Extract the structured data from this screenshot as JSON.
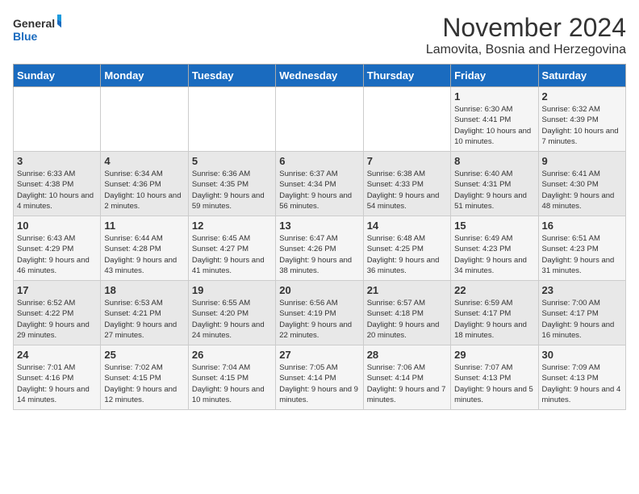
{
  "logo": {
    "general": "General",
    "blue": "Blue"
  },
  "title": "November 2024",
  "subtitle": "Lamovita, Bosnia and Herzegovina",
  "days_of_week": [
    "Sunday",
    "Monday",
    "Tuesday",
    "Wednesday",
    "Thursday",
    "Friday",
    "Saturday"
  ],
  "weeks": [
    [
      {
        "day": "",
        "info": ""
      },
      {
        "day": "",
        "info": ""
      },
      {
        "day": "",
        "info": ""
      },
      {
        "day": "",
        "info": ""
      },
      {
        "day": "",
        "info": ""
      },
      {
        "day": "1",
        "info": "Sunrise: 6:30 AM\nSunset: 4:41 PM\nDaylight: 10 hours and 10 minutes."
      },
      {
        "day": "2",
        "info": "Sunrise: 6:32 AM\nSunset: 4:39 PM\nDaylight: 10 hours and 7 minutes."
      }
    ],
    [
      {
        "day": "3",
        "info": "Sunrise: 6:33 AM\nSunset: 4:38 PM\nDaylight: 10 hours and 4 minutes."
      },
      {
        "day": "4",
        "info": "Sunrise: 6:34 AM\nSunset: 4:36 PM\nDaylight: 10 hours and 2 minutes."
      },
      {
        "day": "5",
        "info": "Sunrise: 6:36 AM\nSunset: 4:35 PM\nDaylight: 9 hours and 59 minutes."
      },
      {
        "day": "6",
        "info": "Sunrise: 6:37 AM\nSunset: 4:34 PM\nDaylight: 9 hours and 56 minutes."
      },
      {
        "day": "7",
        "info": "Sunrise: 6:38 AM\nSunset: 4:33 PM\nDaylight: 9 hours and 54 minutes."
      },
      {
        "day": "8",
        "info": "Sunrise: 6:40 AM\nSunset: 4:31 PM\nDaylight: 9 hours and 51 minutes."
      },
      {
        "day": "9",
        "info": "Sunrise: 6:41 AM\nSunset: 4:30 PM\nDaylight: 9 hours and 48 minutes."
      }
    ],
    [
      {
        "day": "10",
        "info": "Sunrise: 6:43 AM\nSunset: 4:29 PM\nDaylight: 9 hours and 46 minutes."
      },
      {
        "day": "11",
        "info": "Sunrise: 6:44 AM\nSunset: 4:28 PM\nDaylight: 9 hours and 43 minutes."
      },
      {
        "day": "12",
        "info": "Sunrise: 6:45 AM\nSunset: 4:27 PM\nDaylight: 9 hours and 41 minutes."
      },
      {
        "day": "13",
        "info": "Sunrise: 6:47 AM\nSunset: 4:26 PM\nDaylight: 9 hours and 38 minutes."
      },
      {
        "day": "14",
        "info": "Sunrise: 6:48 AM\nSunset: 4:25 PM\nDaylight: 9 hours and 36 minutes."
      },
      {
        "day": "15",
        "info": "Sunrise: 6:49 AM\nSunset: 4:23 PM\nDaylight: 9 hours and 34 minutes."
      },
      {
        "day": "16",
        "info": "Sunrise: 6:51 AM\nSunset: 4:23 PM\nDaylight: 9 hours and 31 minutes."
      }
    ],
    [
      {
        "day": "17",
        "info": "Sunrise: 6:52 AM\nSunset: 4:22 PM\nDaylight: 9 hours and 29 minutes."
      },
      {
        "day": "18",
        "info": "Sunrise: 6:53 AM\nSunset: 4:21 PM\nDaylight: 9 hours and 27 minutes."
      },
      {
        "day": "19",
        "info": "Sunrise: 6:55 AM\nSunset: 4:20 PM\nDaylight: 9 hours and 24 minutes."
      },
      {
        "day": "20",
        "info": "Sunrise: 6:56 AM\nSunset: 4:19 PM\nDaylight: 9 hours and 22 minutes."
      },
      {
        "day": "21",
        "info": "Sunrise: 6:57 AM\nSunset: 4:18 PM\nDaylight: 9 hours and 20 minutes."
      },
      {
        "day": "22",
        "info": "Sunrise: 6:59 AM\nSunset: 4:17 PM\nDaylight: 9 hours and 18 minutes."
      },
      {
        "day": "23",
        "info": "Sunrise: 7:00 AM\nSunset: 4:17 PM\nDaylight: 9 hours and 16 minutes."
      }
    ],
    [
      {
        "day": "24",
        "info": "Sunrise: 7:01 AM\nSunset: 4:16 PM\nDaylight: 9 hours and 14 minutes."
      },
      {
        "day": "25",
        "info": "Sunrise: 7:02 AM\nSunset: 4:15 PM\nDaylight: 9 hours and 12 minutes."
      },
      {
        "day": "26",
        "info": "Sunrise: 7:04 AM\nSunset: 4:15 PM\nDaylight: 9 hours and 10 minutes."
      },
      {
        "day": "27",
        "info": "Sunrise: 7:05 AM\nSunset: 4:14 PM\nDaylight: 9 hours and 9 minutes."
      },
      {
        "day": "28",
        "info": "Sunrise: 7:06 AM\nSunset: 4:14 PM\nDaylight: 9 hours and 7 minutes."
      },
      {
        "day": "29",
        "info": "Sunrise: 7:07 AM\nSunset: 4:13 PM\nDaylight: 9 hours and 5 minutes."
      },
      {
        "day": "30",
        "info": "Sunrise: 7:09 AM\nSunset: 4:13 PM\nDaylight: 9 hours and 4 minutes."
      }
    ]
  ]
}
